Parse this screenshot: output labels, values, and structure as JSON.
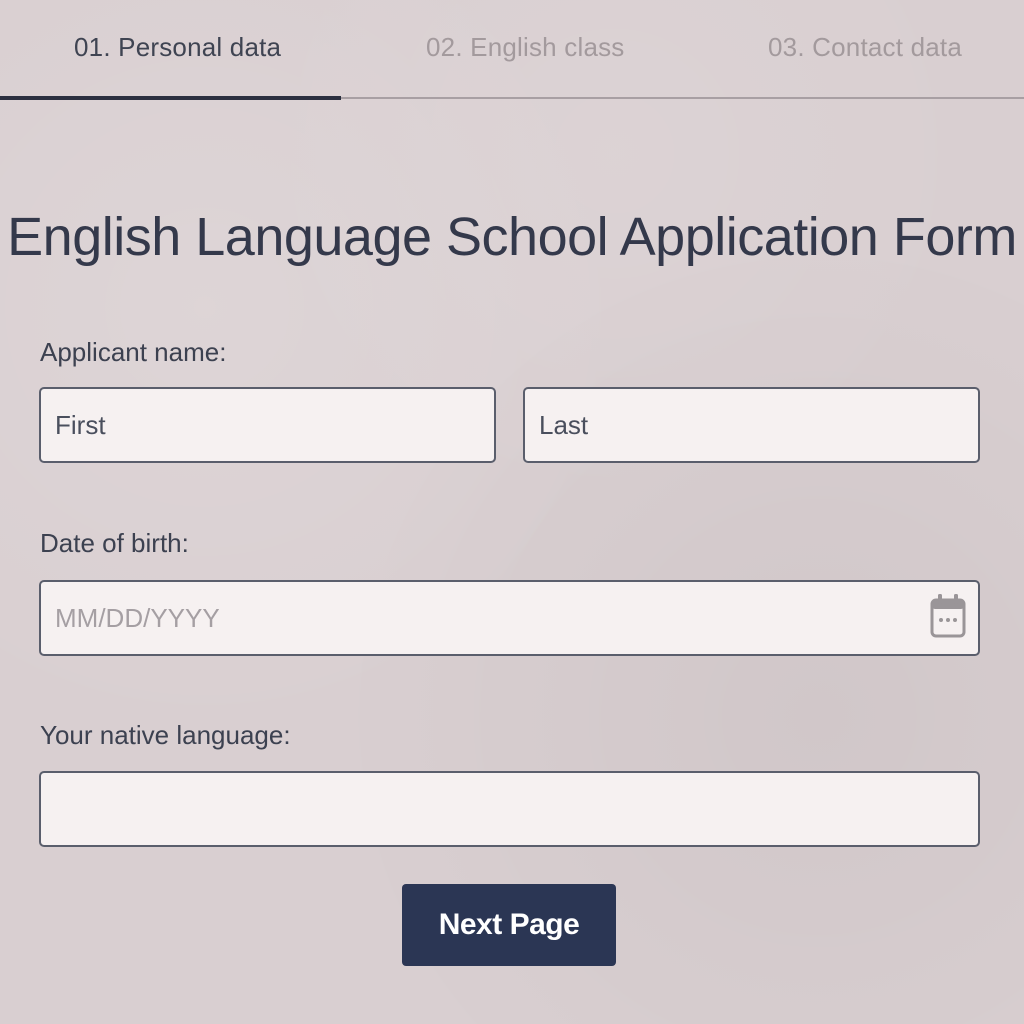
{
  "steps": [
    {
      "label": "01. Personal data",
      "state": "active"
    },
    {
      "label": "02. English class",
      "state": "inactive"
    },
    {
      "label": "03. Contact data",
      "state": "inactive"
    }
  ],
  "progress": {
    "completed_steps": 1,
    "total_steps": 3
  },
  "form": {
    "title": "English Language School Application Form",
    "applicant_label": "Applicant name:",
    "first_placeholder": "First",
    "last_placeholder": "Last",
    "dob_label": "Date of birth:",
    "dob_placeholder": "MM/DD/YYYY",
    "dob_icon": "calendar-icon",
    "native_label": "Your native language:",
    "native_value": "",
    "next_label": "Next Page"
  },
  "colors": {
    "background": "#d9cfd1",
    "button": "#2b3654",
    "progress": "#2c3040",
    "inactive_step": "#a39a9d"
  }
}
